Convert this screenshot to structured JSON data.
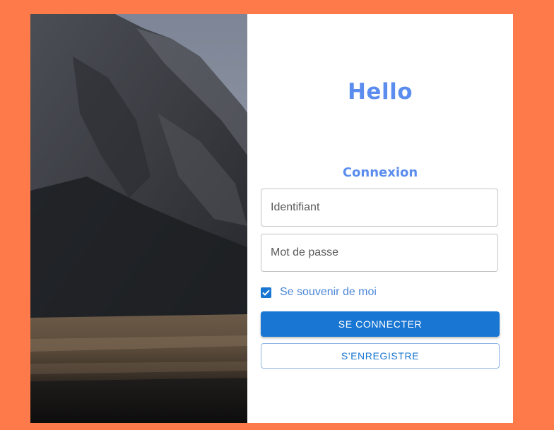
{
  "panel": {
    "hello": "Hello",
    "subtitle": "Connexion",
    "username_placeholder": "Identifiant",
    "password_placeholder": "Mot de passe",
    "remember_label": "Se souvenir de moi",
    "remember_checked": true,
    "login_button": "SE CONNECTER",
    "register_button": "S'ENREGISTRE"
  },
  "colors": {
    "background": "#ff7a4a",
    "accent": "#5b8def",
    "primary": "#1976d2"
  },
  "icons": {
    "checkbox": "check-icon"
  }
}
